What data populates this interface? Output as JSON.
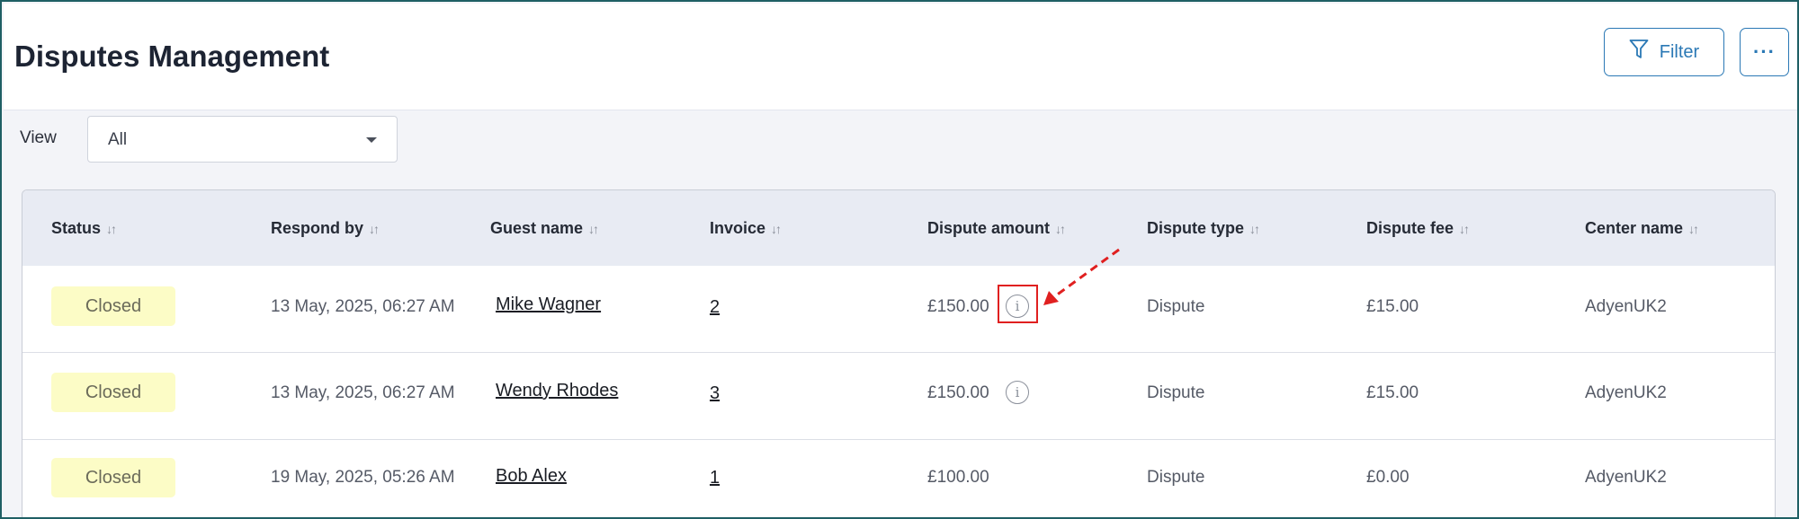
{
  "header": {
    "title": "Disputes Management",
    "filter_label": "Filter",
    "more_label": "···"
  },
  "view": {
    "label": "View",
    "selected": "All"
  },
  "table": {
    "columns": [
      "Status",
      "Respond by",
      "Guest name",
      "Invoice",
      "Dispute amount",
      "Dispute type",
      "Dispute fee",
      "Center name"
    ],
    "sort_glyph": "↓↑",
    "rows": [
      {
        "status": "Closed",
        "respond_by": "13 May, 2025, 06:27 AM",
        "guest_name": "Mike Wagner",
        "invoice": "2",
        "dispute_amount": "£150.00",
        "has_info": true,
        "dispute_type": "Dispute",
        "dispute_fee": "£15.00",
        "center_name": "AdyenUK2"
      },
      {
        "status": "Closed",
        "respond_by": "13 May, 2025, 06:27 AM",
        "guest_name": "Wendy Rhodes",
        "invoice": "3",
        "dispute_amount": "£150.00",
        "has_info": true,
        "dispute_type": "Dispute",
        "dispute_fee": "£15.00",
        "center_name": "AdyenUK2"
      },
      {
        "status": "Closed",
        "respond_by": "19 May, 2025, 05:26 AM",
        "guest_name": "Bob Alex",
        "invoice": "1",
        "dispute_amount": "£100.00",
        "has_info": false,
        "dispute_type": "Dispute",
        "dispute_fee": "£0.00",
        "center_name": "AdyenUK2"
      }
    ]
  },
  "icons": {
    "filter": "funnel-icon",
    "info": "info-circle-icon"
  },
  "colors": {
    "accent": "#2a78b5",
    "badge_bg": "#fcfcc6",
    "highlight": "#e02020"
  }
}
